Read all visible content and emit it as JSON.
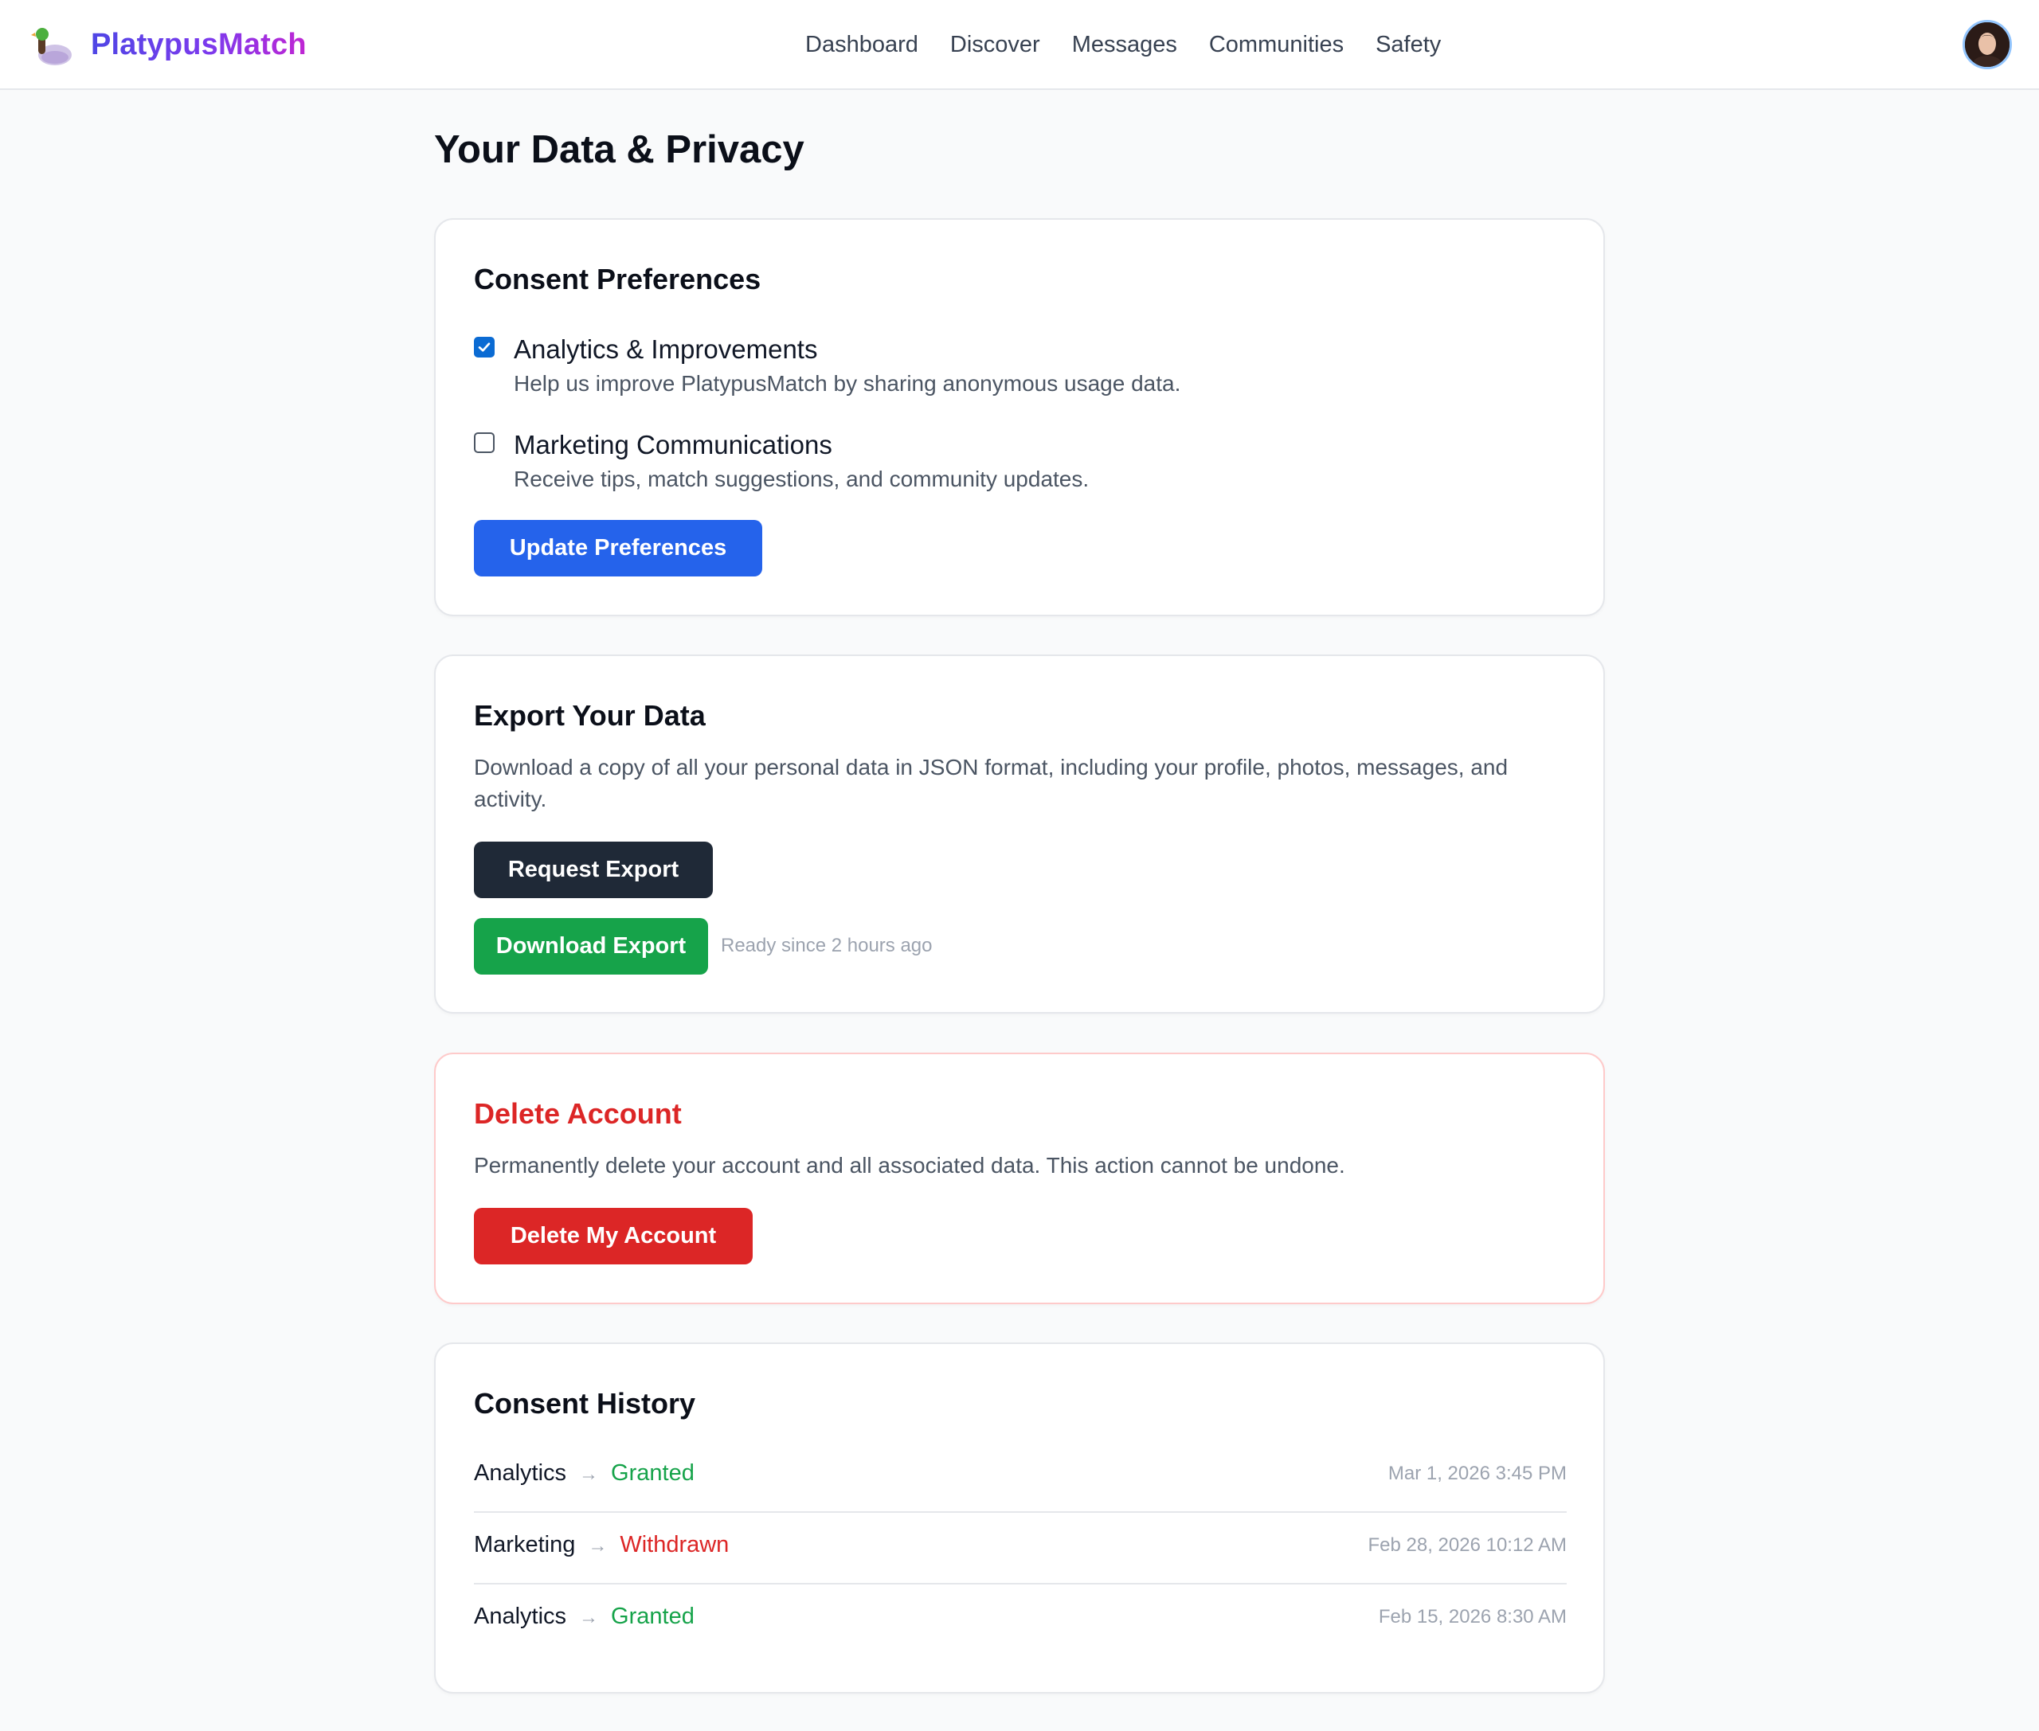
{
  "header": {
    "brand": "PlatypusMatch",
    "nav": [
      "Dashboard",
      "Discover",
      "Messages",
      "Communities",
      "Safety"
    ]
  },
  "page": {
    "title": "Your Data & Privacy"
  },
  "consent": {
    "title": "Consent Preferences",
    "options": [
      {
        "label": "Analytics & Improvements",
        "description": "Help us improve PlatypusMatch by sharing anonymous usage data.",
        "checked": true
      },
      {
        "label": "Marketing Communications",
        "description": "Receive tips, match suggestions, and community updates.",
        "checked": false
      }
    ],
    "button": "Update Preferences"
  },
  "export": {
    "title": "Export Your Data",
    "description": "Download a copy of all your personal data in JSON format, including your profile, photos, messages, and activity.",
    "request_button": "Request Export",
    "download_button": "Download Export",
    "status": "Ready since 2 hours ago"
  },
  "delete": {
    "title": "Delete Account",
    "description": "Permanently delete your account and all associated data. This action cannot be undone.",
    "button": "Delete My Account"
  },
  "history": {
    "title": "Consent History",
    "arrow": "→",
    "rows": [
      {
        "type": "Analytics",
        "status": "Granted",
        "date": "Mar 1, 2026 3:45 PM"
      },
      {
        "type": "Marketing",
        "status": "Withdrawn",
        "date": "Feb 28, 2026 10:12 AM"
      },
      {
        "type": "Analytics",
        "status": "Granted",
        "date": "Feb 15, 2026 8:30 AM"
      }
    ]
  },
  "colors": {
    "primary": "#2563eb",
    "dark": "#1f2937",
    "success": "#16a34a",
    "danger": "#dc2626"
  },
  "icons": {
    "logo": "platypus-logo-icon",
    "checkbox_checked": "check-icon",
    "avatar": "user-avatar"
  }
}
